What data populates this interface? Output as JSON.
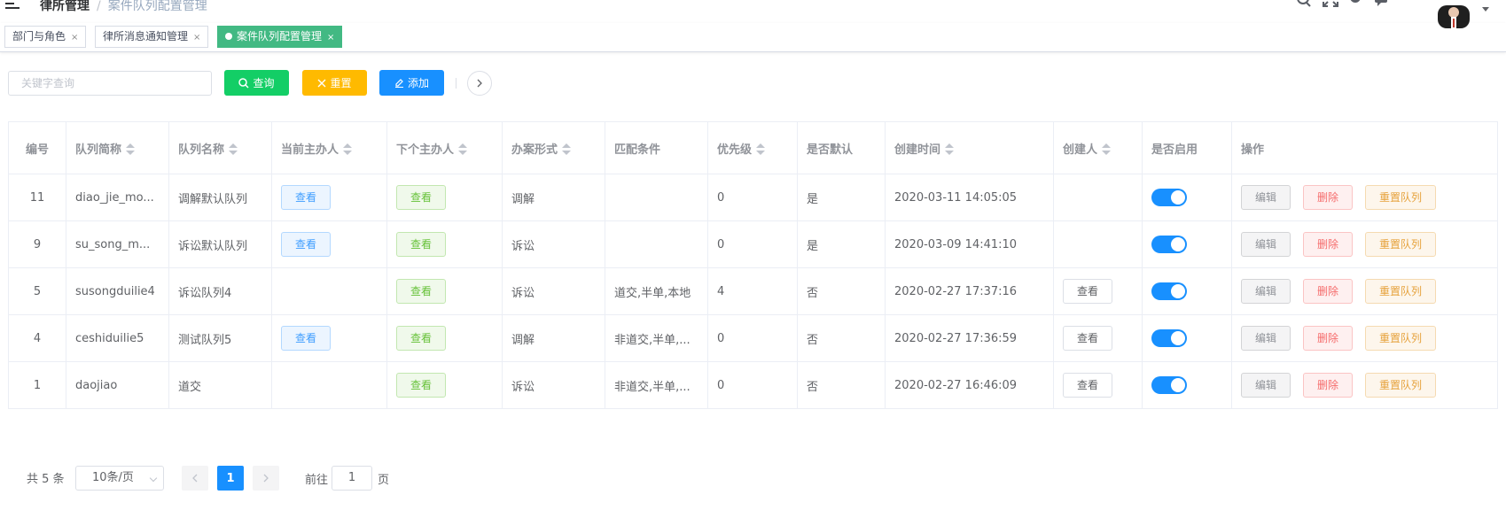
{
  "breadcrumb": {
    "first": "律所管理",
    "separator": "/",
    "current": "案件队列配置管理"
  },
  "tags": [
    {
      "label": "部门与角色",
      "close": "×"
    },
    {
      "label": "律所消息通知管理",
      "close": "×"
    },
    {
      "label": "案件队列配置管理",
      "close": "×",
      "active": true
    }
  ],
  "search": {
    "placeholder": "关键字查询",
    "value": ""
  },
  "toolbar": {
    "query_label": "查询",
    "reset_label": "重置",
    "add_label": "添加"
  },
  "table": {
    "headers": [
      "编号",
      "队列简称",
      "队列名称",
      "当前主办人",
      "下个主办人",
      "办案形式",
      "匹配条件",
      "优先级",
      "是否默认",
      "创建时间",
      "创建人",
      "是否启用",
      "操作"
    ],
    "view_label": "查看",
    "edit_label": "编辑",
    "delete_label": "删除",
    "reset_queue_label": "重置队列",
    "rows": [
      {
        "id": "11",
        "short": "diao_jie_mo...",
        "name": "调解默认队列",
        "cur_view": true,
        "next_view": true,
        "form": "调解",
        "match": "",
        "priority": "0",
        "default": "是",
        "created": "2020-03-11 14:05:05",
        "creator_view": false,
        "enabled": true
      },
      {
        "id": "9",
        "short": "su_song_m...",
        "name": "诉讼默认队列",
        "cur_view": true,
        "next_view": true,
        "form": "诉讼",
        "match": "",
        "priority": "0",
        "default": "是",
        "created": "2020-03-09 14:41:10",
        "creator_view": false,
        "enabled": true
      },
      {
        "id": "5",
        "short": "susongduilie4",
        "name": "诉讼队列4",
        "cur_view": false,
        "next_view": true,
        "form": "诉讼",
        "match": "道交,半单,本地",
        "priority": "4",
        "default": "否",
        "created": "2020-02-27 17:37:16",
        "creator_view": true,
        "enabled": true
      },
      {
        "id": "4",
        "short": "ceshiduilie5",
        "name": "测试队列5",
        "cur_view": true,
        "next_view": true,
        "form": "调解",
        "match": "非道交,半单,...",
        "priority": "0",
        "default": "否",
        "created": "2020-02-27 17:36:59",
        "creator_view": true,
        "enabled": true
      },
      {
        "id": "1",
        "short": "daojiao",
        "name": "道交",
        "cur_view": false,
        "next_view": true,
        "form": "诉讼",
        "match": "非道交,半单,...",
        "priority": "0",
        "default": "否",
        "created": "2020-02-27 16:46:09",
        "creator_view": true,
        "enabled": true
      }
    ]
  },
  "pagination": {
    "total_label": "共 5 条",
    "page_size": "10条/页",
    "current_page": "1",
    "goto_prefix": "前往",
    "goto_value": "1",
    "goto_suffix": "页"
  },
  "colors": {
    "green": "#13ce66",
    "orange": "#ffba00",
    "blue": "#1890ff",
    "tag_active": "#42b983"
  }
}
